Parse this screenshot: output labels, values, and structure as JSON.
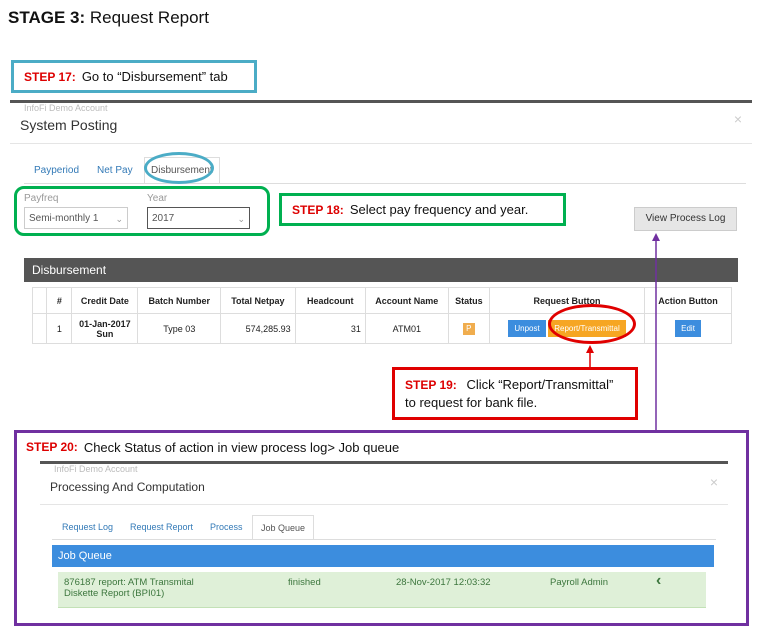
{
  "stage": {
    "number": "STAGE 3:",
    "title": "Request Report"
  },
  "steps": {
    "s17": {
      "num": "STEP 17:",
      "text": "Go to “Disbursement” tab"
    },
    "s18": {
      "num": "STEP 18:",
      "text": "Select pay frequency and year."
    },
    "s19": {
      "num": "STEP 19:",
      "text_line1": "Click “Report/Transmittal”",
      "text_line2": "to request for bank file."
    },
    "s20": {
      "num": "STEP 20:",
      "text": "Check Status of action  in view process log> Job queue"
    }
  },
  "system_posting": {
    "ghost_text": "InfoFi Demo Account",
    "title": "System Posting",
    "close": "×",
    "tabs": [
      "Payperiod",
      "Net Pay",
      "Disbursement"
    ],
    "payfreq": {
      "label": "Payfreq",
      "value": "Semi-monthly 1"
    },
    "year": {
      "label": "Year",
      "value": "2017"
    },
    "view_process_log": "View Process Log",
    "panel_title": "Disbursement",
    "columns": [
      "#",
      "Credit Date",
      "Batch Number",
      "Total Netpay",
      "Headcount",
      "Account Name",
      "Status",
      "Request Button",
      "Action Button"
    ],
    "row": {
      "num": "1",
      "credit_date_l1": "01-Jan-2017",
      "credit_date_l2": "Sun",
      "batch": "Type 03",
      "netpay": "574,285.93",
      "headcount": "31",
      "account": "ATM01",
      "status": "P",
      "unpost": "Unpost",
      "report": "Report/Transmittal",
      "edit": "Edit"
    }
  },
  "processing": {
    "ghost_text": "InfoFi Demo Account",
    "title": "Processing And Computation",
    "close": "×",
    "tabs": [
      "Request Log",
      "Request Report",
      "Process",
      "Job Queue"
    ],
    "panel_title": "Job Queue",
    "row": {
      "desc_l1": "876187 report: ATM Transmital",
      "desc_l2": "Diskette Report (BPI01)",
      "status": "finished",
      "date": "28-Nov-2017 12:03:32",
      "user": "Payroll Admin",
      "icon": "‹"
    }
  },
  "colors": {
    "cyan": "#4bacc6",
    "green": "#00b050",
    "red": "#e00000",
    "purple": "#7030a0",
    "step_red": "#dd0000"
  }
}
